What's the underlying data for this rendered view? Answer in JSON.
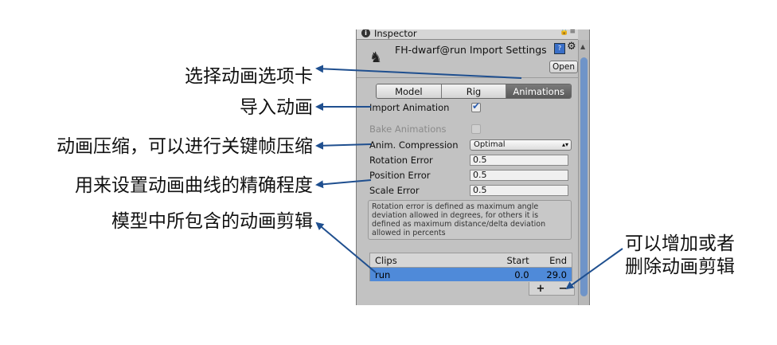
{
  "annotations": {
    "select_tab": "选择动画选项卡",
    "import": "导入动画",
    "compression": "动画压缩，可以进行关键帧压缩",
    "error": "用来设置动画曲线的精确程度",
    "clips": "模型中所包含的动画剪辑",
    "add_remove_line1": "可以增加或者",
    "add_remove_line2": "删除动画剪辑"
  },
  "inspector": {
    "tab_title": "Inspector",
    "asset_title": "FH-dwarf@run Import Settings",
    "open_label": "Open",
    "tabs": [
      {
        "label": "Model"
      },
      {
        "label": "Rig"
      },
      {
        "label": "Animations",
        "active": true
      }
    ],
    "import_animation_label": "Import Animation",
    "import_animation_checked": true,
    "bake_animations_label": "Bake Animations",
    "bake_animations_checked": false,
    "anim_compression_label": "Anim. Compression",
    "anim_compression_value": "Optimal",
    "rotation_error_label": "Rotation Error",
    "rotation_error_value": "0.5",
    "position_error_label": "Position Error",
    "position_error_value": "0.5",
    "scale_error_label": "Scale Error",
    "scale_error_value": "0.5",
    "help_text": "Rotation error is defined as maximum angle deviation allowed in degrees, for others it is defined as maximum distance/delta deviation allowed in percents",
    "clips": {
      "headers": {
        "name": "Clips",
        "start": "Start",
        "end": "End"
      },
      "rows": [
        {
          "name": "run",
          "start": "0.0",
          "end": "29.0"
        }
      ],
      "add_label": "+",
      "remove_label": "−"
    }
  },
  "colors": {
    "arrow": "#1f4f8f",
    "selection": "#4f8ad9",
    "scroll_thumb": "#6f94c8"
  }
}
